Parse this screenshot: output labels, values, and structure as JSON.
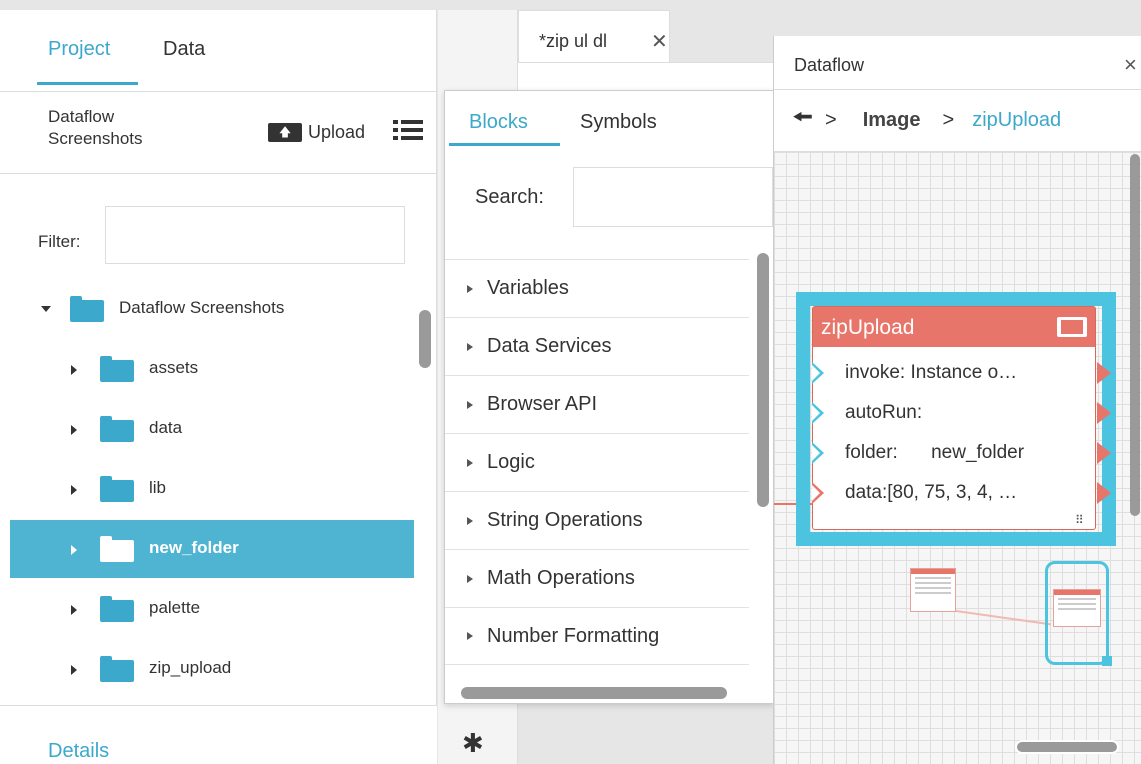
{
  "left_panel": {
    "tabs": [
      {
        "label": "Project"
      },
      {
        "label": "Data"
      }
    ],
    "project_title": "Dataflow Screenshots",
    "upload_label": "Upload",
    "filter_label": "Filter:",
    "tree": [
      {
        "label": "Dataflow Screenshots",
        "expanded": true
      },
      {
        "label": "assets"
      },
      {
        "label": "data"
      },
      {
        "label": "lib"
      },
      {
        "label": "new_folder",
        "selected": true
      },
      {
        "label": "palette"
      },
      {
        "label": "zip_upload"
      }
    ],
    "details_label": "Details"
  },
  "editor_tab": {
    "label": "*zip ul dl",
    "close": "✕"
  },
  "blocks_panel": {
    "tabs": [
      {
        "label": "Blocks"
      },
      {
        "label": "Symbols"
      }
    ],
    "search_label": "Search:",
    "categories": [
      "Variables",
      "Data Services",
      "Browser API",
      "Logic",
      "String Operations",
      "Math Operations",
      "Number Formatting"
    ]
  },
  "dataflow": {
    "title": "Dataflow",
    "close": "×",
    "back_arrow": "🠘",
    "breadcrumb": [
      ">",
      "Image",
      ">",
      "zipUpload"
    ],
    "node": {
      "title": "zipUpload",
      "ports": [
        {
          "label": "invoke:",
          "value": "Instance o…"
        },
        {
          "label": "autoRun:",
          "value": ""
        },
        {
          "label": "folder:",
          "value": "new_folder"
        },
        {
          "label": "data:",
          "value": "[80, 75, 3, 4, …"
        }
      ]
    }
  },
  "colors": {
    "accent": "#3ba8cc",
    "node": "#e8756a",
    "selection": "#4cc3df"
  }
}
